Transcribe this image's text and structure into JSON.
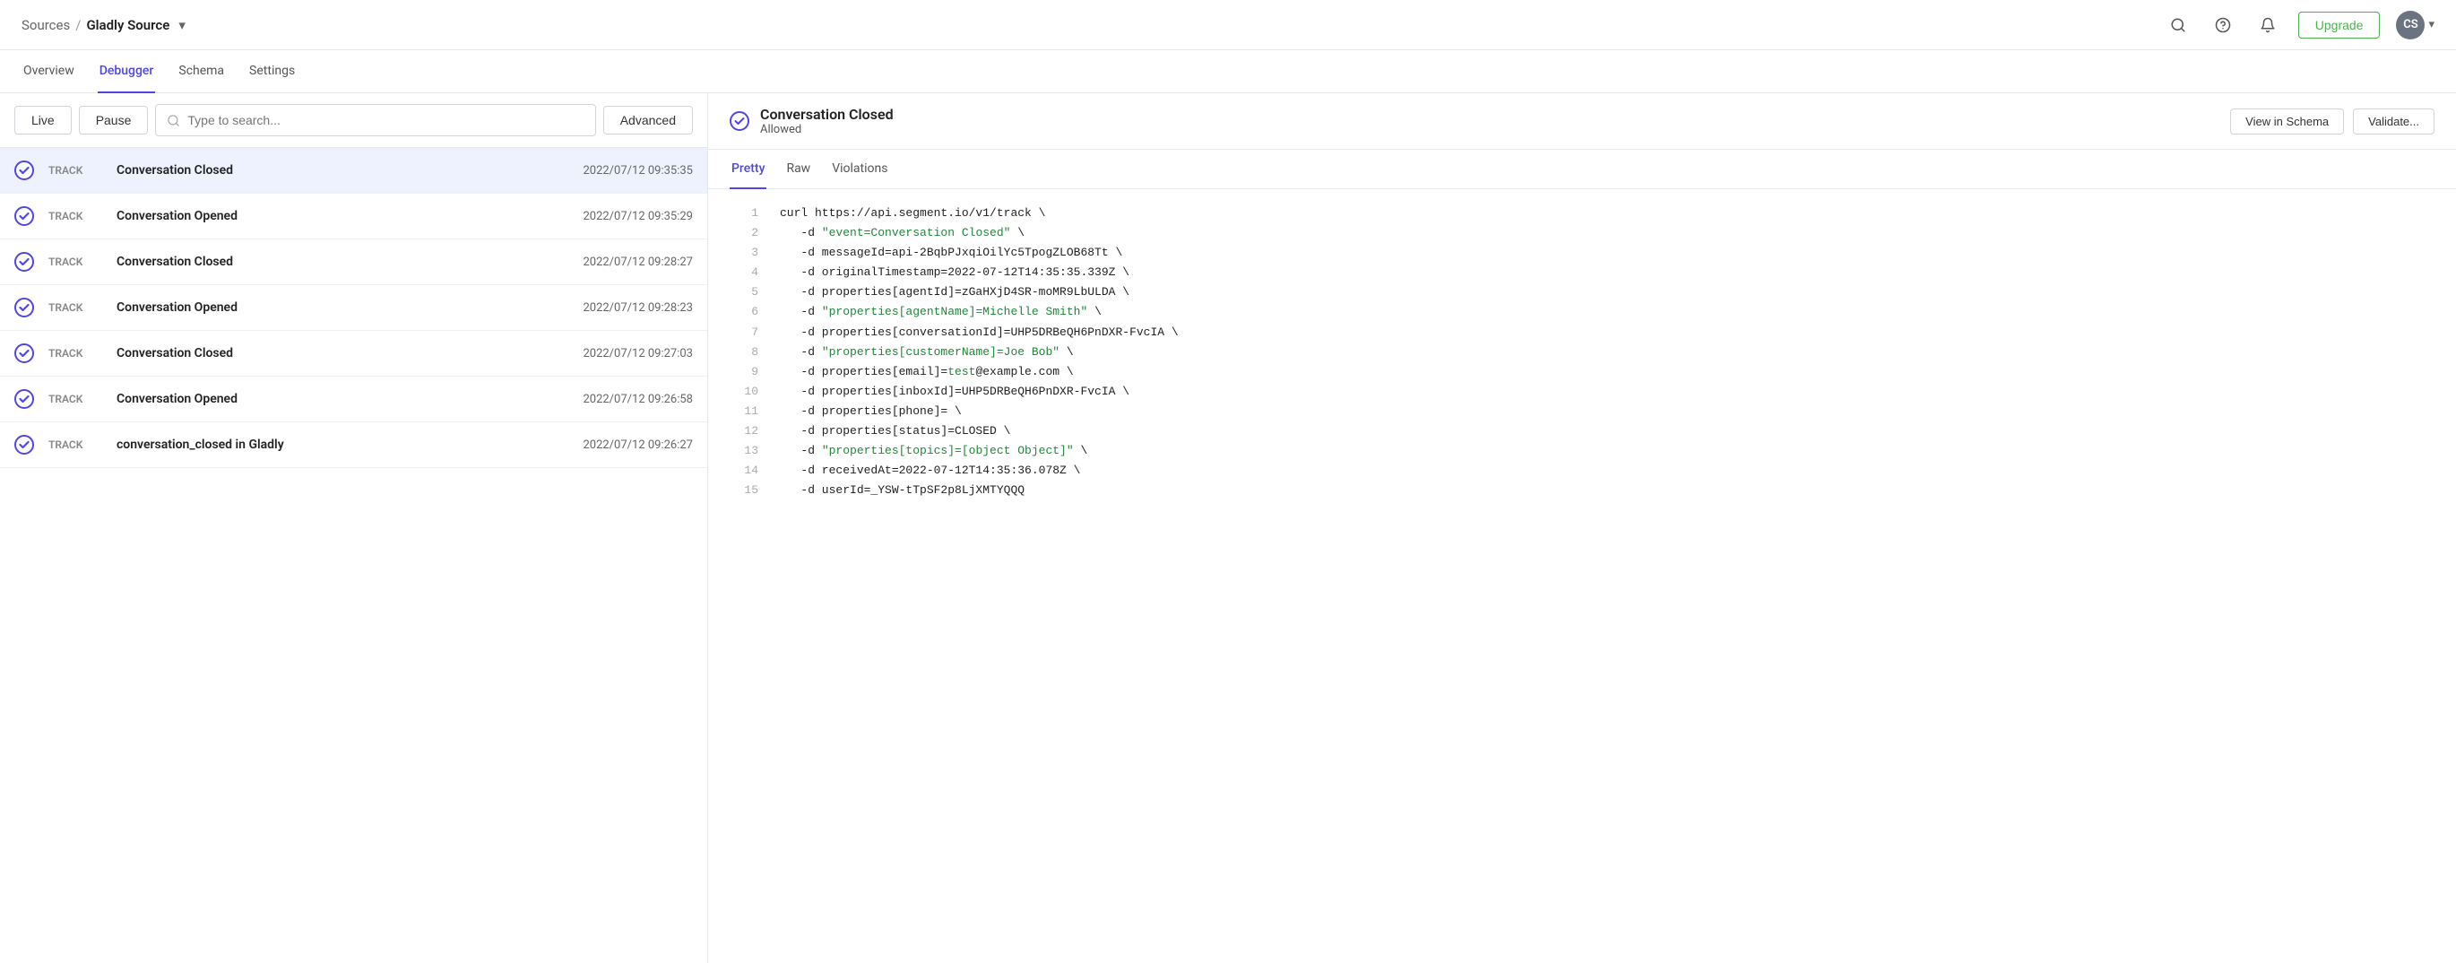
{
  "header": {
    "sources_label": "Sources",
    "separator": "/",
    "title": "Gladly Source",
    "upgrade_label": "Upgrade",
    "avatar_initials": "CS",
    "search_tooltip": "Search",
    "help_tooltip": "Help",
    "bell_tooltip": "Notifications"
  },
  "tabs": [
    {
      "id": "overview",
      "label": "Overview",
      "active": false
    },
    {
      "id": "debugger",
      "label": "Debugger",
      "active": true
    },
    {
      "id": "schema",
      "label": "Schema",
      "active": false
    },
    {
      "id": "settings",
      "label": "Settings",
      "active": false
    }
  ],
  "toolbar": {
    "live_label": "Live",
    "pause_label": "Pause",
    "search_placeholder": "Type to search...",
    "advanced_label": "Advanced"
  },
  "events": [
    {
      "type": "TRACK",
      "name": "Conversation Closed",
      "time": "2022/07/12 09:35:35",
      "selected": true
    },
    {
      "type": "TRACK",
      "name": "Conversation Opened",
      "time": "2022/07/12 09:35:29",
      "selected": false
    },
    {
      "type": "TRACK",
      "name": "Conversation Closed",
      "time": "2022/07/12 09:28:27",
      "selected": false
    },
    {
      "type": "TRACK",
      "name": "Conversation Opened",
      "time": "2022/07/12 09:28:23",
      "selected": false
    },
    {
      "type": "TRACK",
      "name": "Conversation Closed",
      "time": "2022/07/12 09:27:03",
      "selected": false
    },
    {
      "type": "TRACK",
      "name": "Conversation Opened",
      "time": "2022/07/12 09:26:58",
      "selected": false
    },
    {
      "type": "TRACK",
      "name": "conversation_closed in Gladly",
      "time": "2022/07/12 09:26:27",
      "selected": false
    }
  ],
  "detail": {
    "title": "Conversation Closed",
    "status": "Allowed",
    "view_in_schema_label": "View in Schema",
    "validate_label": "Validate...",
    "sub_tabs": [
      {
        "id": "pretty",
        "label": "Pretty",
        "active": true
      },
      {
        "id": "raw",
        "label": "Raw",
        "active": false
      },
      {
        "id": "violations",
        "label": "Violations",
        "active": false
      }
    ],
    "code_lines": [
      {
        "num": 1,
        "parts": [
          {
            "text": "curl https://api.segment.io/v1/track \\",
            "type": "normal"
          }
        ]
      },
      {
        "num": 2,
        "parts": [
          {
            "text": "   -d ",
            "type": "normal"
          },
          {
            "text": "\"event=Conversation Closed\"",
            "type": "string"
          },
          {
            "text": " \\",
            "type": "normal"
          }
        ]
      },
      {
        "num": 3,
        "parts": [
          {
            "text": "   -d messageId=api-2BqbPJxqiOilYc5TpogZLOB68Tt \\",
            "type": "normal"
          }
        ]
      },
      {
        "num": 4,
        "parts": [
          {
            "text": "   -d originalTimestamp=2022-07-12T14:35:35.339Z \\",
            "type": "normal"
          }
        ]
      },
      {
        "num": 5,
        "parts": [
          {
            "text": "   -d properties[agentId]=zGaHXjD4SR-moMR9LbULDA \\",
            "type": "normal"
          }
        ]
      },
      {
        "num": 6,
        "parts": [
          {
            "text": "   -d ",
            "type": "normal"
          },
          {
            "text": "\"properties[agentName]=Michelle Smith\"",
            "type": "string"
          },
          {
            "text": " \\",
            "type": "normal"
          }
        ]
      },
      {
        "num": 7,
        "parts": [
          {
            "text": "   -d properties[conversationId]=UHP5DRBeQH6PnDXR-FvcIA \\",
            "type": "normal"
          }
        ]
      },
      {
        "num": 8,
        "parts": [
          {
            "text": "   -d ",
            "type": "normal"
          },
          {
            "text": "\"properties[customerName]=Joe Bob\"",
            "type": "string"
          },
          {
            "text": " \\",
            "type": "normal"
          }
        ]
      },
      {
        "num": 9,
        "parts": [
          {
            "text": "   -d properties[email]=",
            "type": "normal"
          },
          {
            "text": "test",
            "type": "string"
          },
          {
            "text": "@example.com \\",
            "type": "normal"
          }
        ]
      },
      {
        "num": 10,
        "parts": [
          {
            "text": "   -d properties[inboxId]=UHP5DRBeQH6PnDXR-FvcIA \\",
            "type": "normal"
          }
        ]
      },
      {
        "num": 11,
        "parts": [
          {
            "text": "   -d properties[phone]= \\",
            "type": "normal"
          }
        ]
      },
      {
        "num": 12,
        "parts": [
          {
            "text": "   -d properties[status]=CLOSED \\",
            "type": "normal"
          }
        ]
      },
      {
        "num": 13,
        "parts": [
          {
            "text": "   -d ",
            "type": "normal"
          },
          {
            "text": "\"properties[topics]=[object Object]\"",
            "type": "string"
          },
          {
            "text": " \\",
            "type": "normal"
          }
        ]
      },
      {
        "num": 14,
        "parts": [
          {
            "text": "   -d receivedAt=2022-07-12T14:35:36.078Z \\",
            "type": "normal"
          }
        ]
      },
      {
        "num": 15,
        "parts": [
          {
            "text": "   -d userId=_YSW-tTpSF2p8LjXMTYQQQ",
            "type": "normal"
          }
        ]
      }
    ]
  }
}
